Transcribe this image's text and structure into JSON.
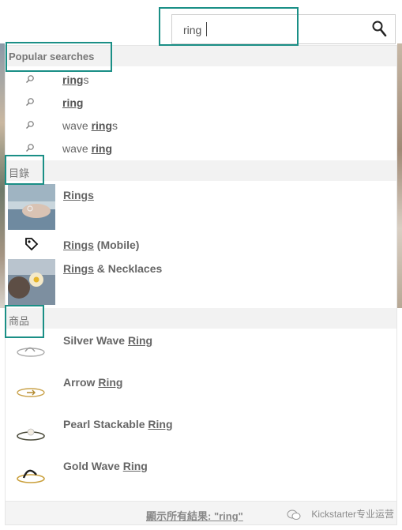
{
  "search": {
    "value": "ring"
  },
  "popular": {
    "heading": "Popular searches",
    "items": [
      {
        "match": "ring",
        "rest": "s",
        "pre": ""
      },
      {
        "match": "ring",
        "rest": "",
        "pre": ""
      },
      {
        "match": "ring",
        "rest": "s",
        "pre": "wave "
      },
      {
        "match": "ring",
        "rest": "",
        "pre": "wave "
      }
    ]
  },
  "categories": {
    "heading": "目錄",
    "items": [
      {
        "match": "Rings",
        "rest": ""
      },
      {
        "match": "Rings",
        "rest": " (Mobile)"
      },
      {
        "match": "Rings",
        "rest": " & Necklaces"
      }
    ]
  },
  "products": {
    "heading": "商品",
    "items": [
      {
        "pre": "Silver Wave ",
        "match": "Ring"
      },
      {
        "pre": "Arrow ",
        "match": "Ring"
      },
      {
        "pre": "Pearl Stackable ",
        "match": "Ring"
      },
      {
        "pre": "Gold Wave ",
        "match": "Ring"
      }
    ]
  },
  "footer": {
    "show_all": "顯示所有結果: \"ring\""
  },
  "watermark": {
    "text": "Kickstarter专业运营"
  },
  "colors": {
    "highlight": "#1a8f86"
  }
}
